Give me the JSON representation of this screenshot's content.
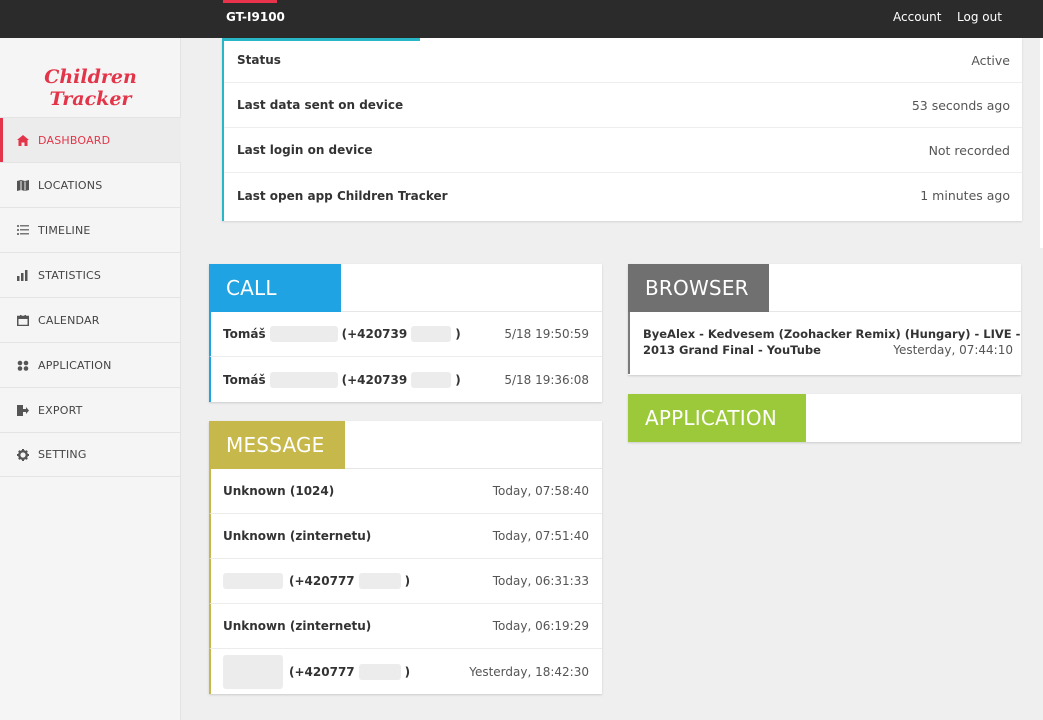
{
  "header": {
    "device": "GT-I9100",
    "account_label": "Account",
    "logout_label": "Log out"
  },
  "sidebar": {
    "logo": "Children Tracker",
    "items": [
      {
        "label": "DASHBOARD",
        "icon": "home-icon",
        "active": true
      },
      {
        "label": "LOCATIONS",
        "icon": "map-icon",
        "active": false
      },
      {
        "label": "TIMELINE",
        "icon": "list-icon",
        "active": false
      },
      {
        "label": "STATISTICS",
        "icon": "bar-chart-icon",
        "active": false
      },
      {
        "label": "CALENDAR",
        "icon": "calendar-icon",
        "active": false
      },
      {
        "label": "APPLICATION",
        "icon": "grid-icon",
        "active": false
      },
      {
        "label": "EXPORT",
        "icon": "export-icon",
        "active": false
      },
      {
        "label": "SETTING",
        "icon": "gear-icon",
        "active": false
      }
    ]
  },
  "status": {
    "rows": [
      {
        "label": "Status",
        "value": "Active"
      },
      {
        "label": "Last data sent on device",
        "value": "53 seconds ago"
      },
      {
        "label": "Last login on device",
        "value": "Not recorded"
      },
      {
        "label": "Last open app Children Tracker",
        "value": "1 minutes ago"
      }
    ]
  },
  "call": {
    "title": "CALL",
    "color": "#1fa3e2",
    "rows": [
      {
        "name": "Tomáš",
        "number": "(+420739",
        "close": ")",
        "time": "5/18 19:50:59"
      },
      {
        "name": "Tomáš",
        "number": "(+420739",
        "close": ")",
        "time": "5/18 19:36:08"
      }
    ]
  },
  "message": {
    "title": "MESSAGE",
    "color": "#c6b84a",
    "rows": [
      {
        "name": "Unknown (1024)",
        "time": "Today, 07:58:40"
      },
      {
        "name": "Unknown (zinternetu)",
        "time": "Today, 07:51:40"
      },
      {
        "number": "(+420777",
        "close": ")",
        "time": "Today, 06:31:33"
      },
      {
        "name": "Unknown (zinternetu)",
        "time": "Today, 06:19:29"
      },
      {
        "number": "(+420777",
        "close": ")",
        "time": "Yesterday, 18:42:30"
      }
    ]
  },
  "browser": {
    "title": "BROWSER",
    "color": "#707070",
    "entry_line1": "ByeAlex - Kedvesem (Zoohacker Remix) (Hungary) - LIVE -",
    "entry_line2": "2013 Grand Final - YouTube",
    "entry_time": "Yesterday, 07:44:10"
  },
  "application": {
    "title": "APPLICATION",
    "color": "#9bc93a"
  }
}
